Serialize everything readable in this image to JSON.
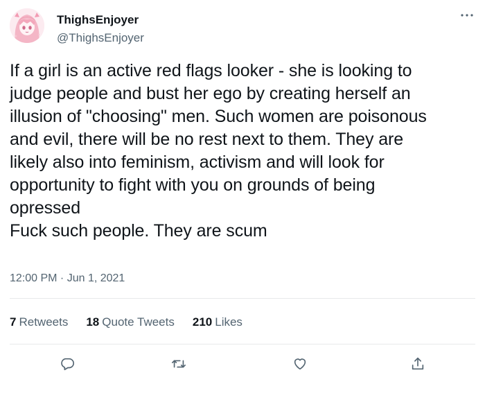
{
  "user": {
    "display_name": "ThighsEnjoyer",
    "handle": "@ThighsEnjoyer",
    "avatar_icon": "anime-avatar-icon"
  },
  "tweet": {
    "text": "If a girl is an active red flags looker - she is looking to\njudge people and bust her ego by creating herself an\nillusion of \"choosing\" men. Such women are poisonous\nand evil, there will be no rest next to them. They are\nlikely also into feminism, activism and will look for\nopportunity to fight with you on grounds of being\nopressed\nFuck such people. They are scum",
    "timestamp": "12:00 PM · Jun 1, 2021"
  },
  "stats": {
    "retweets_count": "7",
    "retweets_label": "Retweets",
    "quotes_count": "18",
    "quotes_label": "Quote Tweets",
    "likes_count": "210",
    "likes_label": "Likes"
  },
  "actions": {
    "reply_icon": "reply-icon",
    "retweet_icon": "retweet-icon",
    "like_icon": "heart-icon",
    "share_icon": "share-icon",
    "more_icon": "more-icon"
  },
  "colors": {
    "primary_text": "#0f1419",
    "secondary_text": "#536471",
    "divider": "#e7e9ea",
    "background": "#ffffff"
  }
}
